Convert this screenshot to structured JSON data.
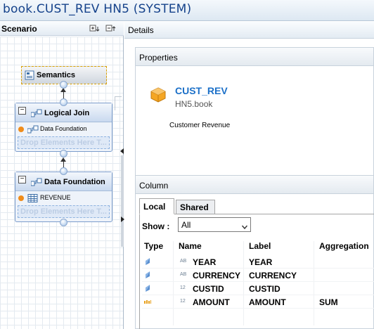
{
  "window": {
    "title": "book.CUST_REV HN5 (SYSTEM)"
  },
  "scenario": {
    "title": "Scenario",
    "nodes": {
      "semantics": {
        "label": "Semantics"
      },
      "logical_join": {
        "title": "Logical Join",
        "input": "Data Foundation",
        "drop_text": "Drop Elements Here T..."
      },
      "data_foundation": {
        "title": "Data Foundation",
        "input": "REVENUE",
        "drop_text": "Drop Elements Here T..."
      }
    }
  },
  "details": {
    "title": "Details",
    "properties": {
      "title": "Properties",
      "name": "CUST_REV",
      "package": "HN5.book",
      "description": "Customer Revenue"
    },
    "column": {
      "title": "Column",
      "tabs": [
        "Local",
        "Shared"
      ],
      "active_tab": "Local",
      "show_label": "Show :",
      "show_value": "All",
      "headers": [
        "Type",
        "Name",
        "Label",
        "Aggregation"
      ],
      "rows": [
        {
          "type": "attribute",
          "datatype": "AB",
          "name": "YEAR",
          "label": "YEAR",
          "aggregation": ""
        },
        {
          "type": "attribute",
          "datatype": "AB",
          "name": "CURRENCY",
          "label": "CURRENCY",
          "aggregation": ""
        },
        {
          "type": "attribute",
          "datatype": "12",
          "name": "CUSTID",
          "label": "CUSTID",
          "aggregation": ""
        },
        {
          "type": "measure",
          "datatype": "12",
          "name": "AMOUNT",
          "label": "AMOUNT",
          "aggregation": "SUM"
        }
      ]
    }
  },
  "colors": {
    "title_text": "#15428b",
    "object_name": "#1c70c8",
    "input_dot": "#f08c1a",
    "measure_icon": "#e8a01c",
    "attribute_icon": "#5a8fd0"
  },
  "icons": [
    "semantics-icon",
    "join-icon",
    "projection-icon",
    "table-icon",
    "cube-icon",
    "attribute-icon",
    "measure-icon",
    "chevron-down-icon"
  ]
}
